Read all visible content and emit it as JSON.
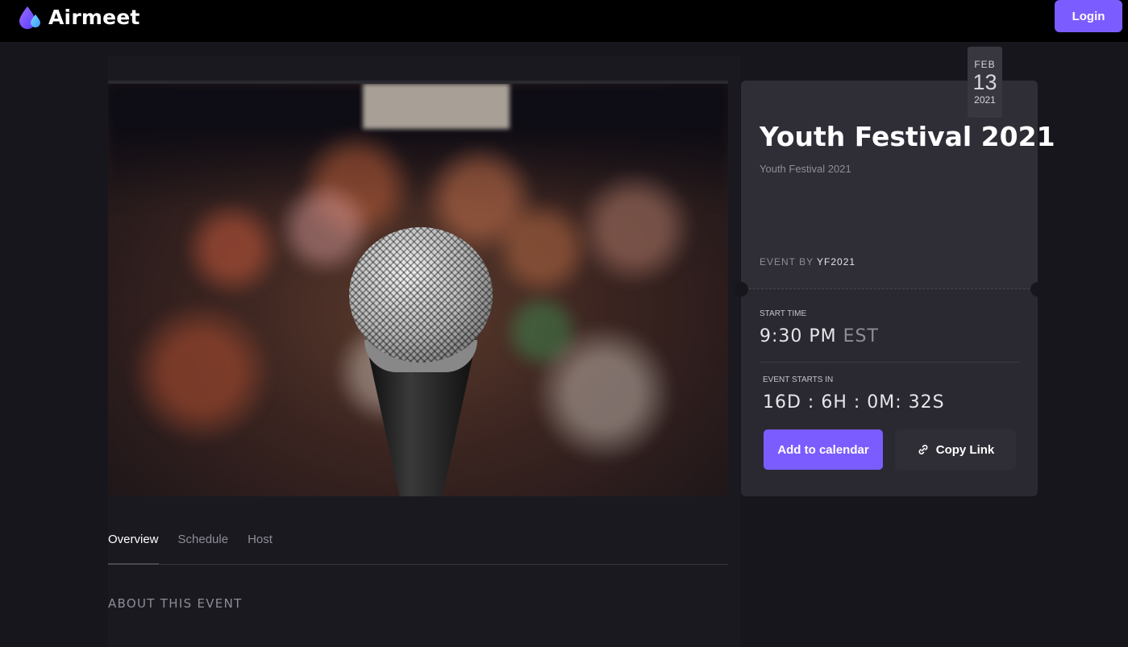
{
  "header": {
    "brand": "Airmeet",
    "login_label": "Login"
  },
  "event": {
    "date_month": "FEB",
    "date_day": "13",
    "date_year": "2021",
    "title": "Youth Festival 2021",
    "subtitle": "Youth Festival 2021",
    "event_by_label": "EVENT BY",
    "organizer": "YF2021",
    "start_time_label": "START TIME",
    "start_time": "9:30 PM",
    "timezone": "EST",
    "starts_in_label": "EVENT STARTS IN",
    "countdown": "16D : 6H : 0M: 32S",
    "add_calendar_label": "Add to calendar",
    "copy_link_label": "Copy Link"
  },
  "tabs": [
    {
      "label": "Overview",
      "active": true
    },
    {
      "label": "Schedule",
      "active": false
    },
    {
      "label": "Host",
      "active": false
    }
  ],
  "about_heading": "ABOUT THIS EVENT",
  "colors": {
    "accent": "#7b5cff",
    "background": "#17161d",
    "card": "#2a2932"
  },
  "icons": {
    "logo": "airmeet-logo-icon",
    "copy": "link-icon"
  }
}
